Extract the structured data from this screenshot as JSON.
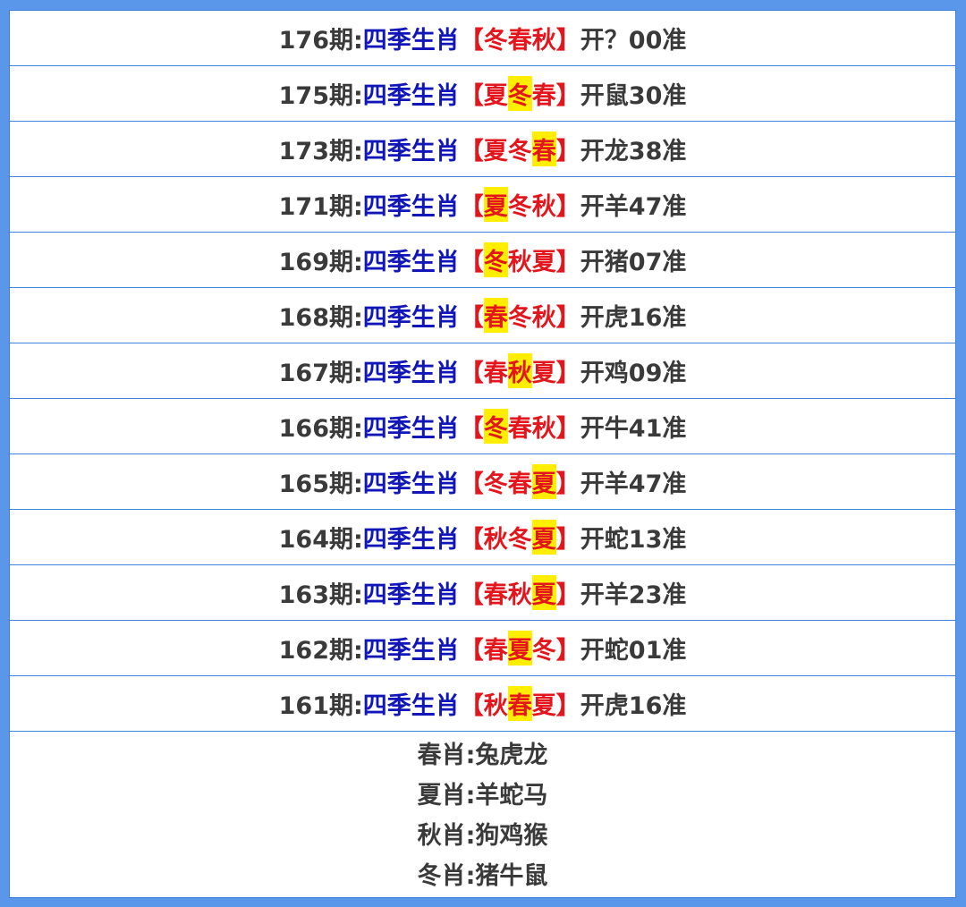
{
  "colors": {
    "frame": "#5a97ea",
    "issue_text": "#3a3a3a",
    "category_text": "#1116b8",
    "season_text": "#e2161c",
    "highlight": "#ffee00",
    "row_border": "#3f83db"
  },
  "rows": [
    {
      "issue": "176期:",
      "category": "四季生肖",
      "open": "【",
      "seasons": [
        "冬",
        "春",
        "秋"
      ],
      "close": "】",
      "result": "开？00准",
      "hit": -1
    },
    {
      "issue": "175期:",
      "category": "四季生肖",
      "open": "【",
      "seasons": [
        "夏",
        "冬",
        "春"
      ],
      "close": "】",
      "result": "开鼠30准",
      "hit": 1
    },
    {
      "issue": "173期:",
      "category": "四季生肖",
      "open": "【",
      "seasons": [
        "夏",
        "冬",
        "春"
      ],
      "close": "】",
      "result": "开龙38准",
      "hit": 2
    },
    {
      "issue": "171期:",
      "category": "四季生肖",
      "open": "【",
      "seasons": [
        "夏",
        "冬",
        "秋"
      ],
      "close": "】",
      "result": "开羊47准",
      "hit": 0
    },
    {
      "issue": "169期:",
      "category": "四季生肖",
      "open": "【",
      "seasons": [
        "冬",
        "秋",
        "夏"
      ],
      "close": "】",
      "result": "开猪07准",
      "hit": 0
    },
    {
      "issue": "168期:",
      "category": "四季生肖",
      "open": "【",
      "seasons": [
        "春",
        "冬",
        "秋"
      ],
      "close": "】",
      "result": "开虎16准",
      "hit": 0
    },
    {
      "issue": "167期:",
      "category": "四季生肖",
      "open": "【",
      "seasons": [
        "春",
        "秋",
        "夏"
      ],
      "close": "】",
      "result": "开鸡09准",
      "hit": 1
    },
    {
      "issue": "166期:",
      "category": "四季生肖",
      "open": "【",
      "seasons": [
        "冬",
        "春",
        "秋"
      ],
      "close": "】",
      "result": "开牛41准",
      "hit": 0
    },
    {
      "issue": "165期:",
      "category": "四季生肖",
      "open": "【",
      "seasons": [
        "冬",
        "春",
        "夏"
      ],
      "close": "】",
      "result": "开羊47准",
      "hit": 2
    },
    {
      "issue": "164期:",
      "category": "四季生肖",
      "open": "【",
      "seasons": [
        "秋",
        "冬",
        "夏"
      ],
      "close": "】",
      "result": "开蛇13准",
      "hit": 2
    },
    {
      "issue": "163期:",
      "category": "四季生肖",
      "open": "【",
      "seasons": [
        "春",
        "秋",
        "夏"
      ],
      "close": "】",
      "result": "开羊23准",
      "hit": 2
    },
    {
      "issue": "162期:",
      "category": "四季生肖",
      "open": "【",
      "seasons": [
        "春",
        "夏",
        "冬"
      ],
      "close": "】",
      "result": "开蛇01准",
      "hit": 1
    },
    {
      "issue": "161期:",
      "category": "四季生肖",
      "open": "【",
      "seasons": [
        "秋",
        "春",
        "夏"
      ],
      "close": "】",
      "result": "开虎16准",
      "hit": 1
    }
  ],
  "legend": [
    "春肖:兔虎龙",
    "夏肖:羊蛇马",
    "秋肖:狗鸡猴",
    "冬肖:猪牛鼠"
  ]
}
